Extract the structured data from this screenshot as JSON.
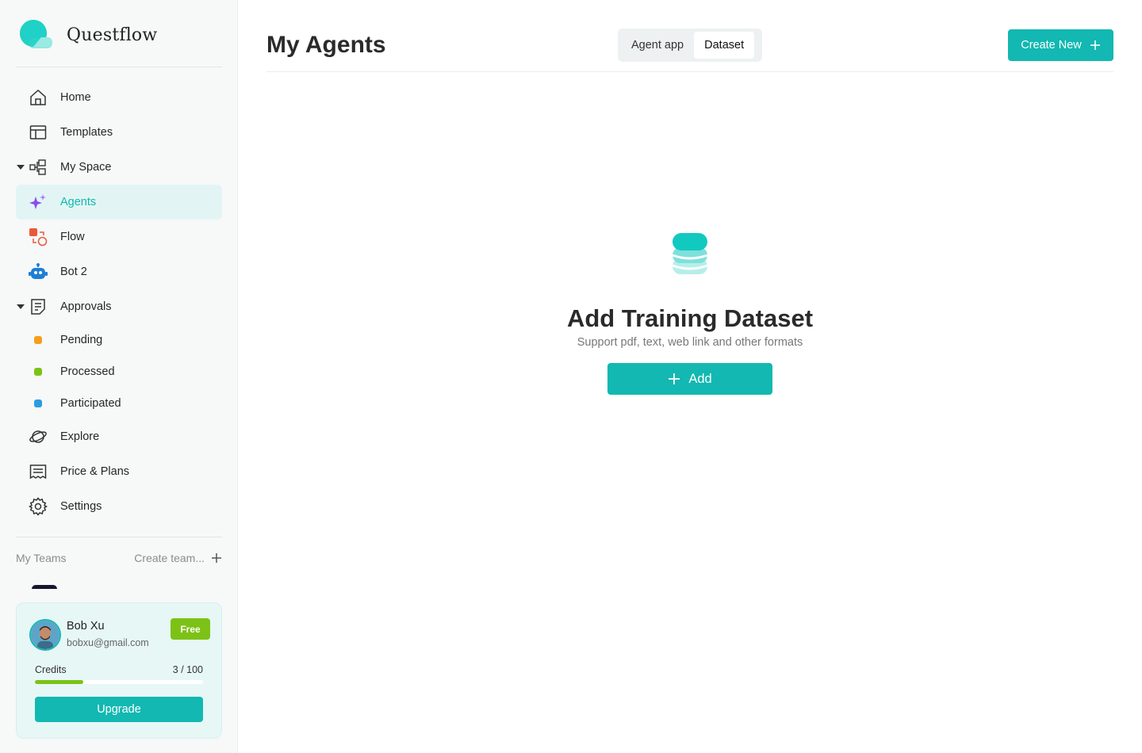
{
  "app": {
    "name": "Questflow"
  },
  "colors": {
    "accent": "#12b8b1",
    "active_bg": "#e2f5f4",
    "free_badge": "#7cc216"
  },
  "sidebar": {
    "items": [
      {
        "label": "Home",
        "icon": "home-icon"
      },
      {
        "label": "Templates",
        "icon": "templates-icon"
      },
      {
        "label": "My Space",
        "icon": "space-icon",
        "expanded": true
      },
      {
        "label": "Agents",
        "icon": "sparkle-icon",
        "active": true
      },
      {
        "label": "Flow",
        "icon": "flow-icon"
      },
      {
        "label": "Bot 2",
        "icon": "bot-icon"
      },
      {
        "label": "Approvals",
        "icon": "approvals-icon",
        "expanded": true
      },
      {
        "label": "Pending",
        "icon": "status-dot",
        "color": "#f5a01a"
      },
      {
        "label": "Processed",
        "icon": "status-dot",
        "color": "#7cc216"
      },
      {
        "label": "Participated",
        "icon": "status-dot",
        "color": "#2a9de0"
      },
      {
        "label": "Explore",
        "icon": "planet-icon"
      },
      {
        "label": "Price & Plans",
        "icon": "receipt-icon"
      },
      {
        "label": "Settings",
        "icon": "gear-icon"
      }
    ],
    "teams": {
      "title": "My Teams",
      "create_label": "Create team..."
    }
  },
  "user": {
    "name": "Bob Xu",
    "email": "bobxu@gmail.com",
    "plan": "Free",
    "credits_label": "Credits",
    "credits_text": "3 / 100",
    "credits_fraction": 0.29,
    "upgrade_label": "Upgrade"
  },
  "main": {
    "title": "My Agents",
    "tabs": [
      {
        "label": "Agent app",
        "active": false
      },
      {
        "label": "Dataset",
        "active": true
      }
    ],
    "create_label": "Create New",
    "empty": {
      "title": "Add Training Dataset",
      "subtitle": "Support pdf, text, web link and other formats",
      "add_label": "Add"
    }
  }
}
